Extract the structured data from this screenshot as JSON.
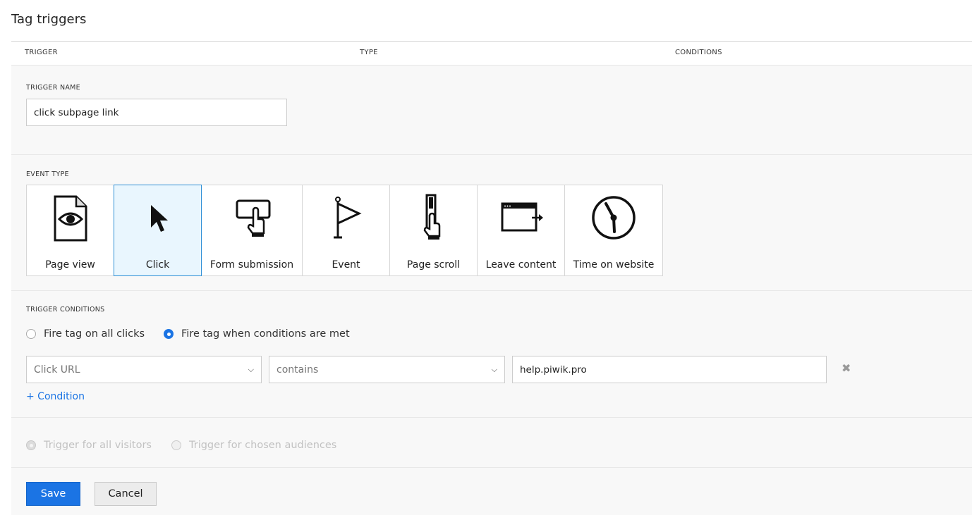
{
  "page": {
    "title": "Tag triggers"
  },
  "columns": {
    "trigger": "TRIGGER",
    "type": "TYPE",
    "conditions": "CONDITIONS"
  },
  "trigger_name": {
    "label": "TRIGGER NAME",
    "value": "click subpage link"
  },
  "event_type": {
    "label": "EVENT TYPE",
    "selected": "Click",
    "options": [
      {
        "label": "Page view",
        "icon": "page-view-icon"
      },
      {
        "label": "Click",
        "icon": "cursor-icon"
      },
      {
        "label": "Form submission",
        "icon": "form-submission-icon"
      },
      {
        "label": "Event",
        "icon": "flag-icon"
      },
      {
        "label": "Page scroll",
        "icon": "page-scroll-icon"
      },
      {
        "label": "Leave content",
        "icon": "leave-content-icon"
      },
      {
        "label": "Time on website",
        "icon": "clock-icon"
      }
    ]
  },
  "conditions": {
    "label": "TRIGGER CONDITIONS",
    "option_all": "Fire tag on all clicks",
    "option_conditional": "Fire tag when conditions are met",
    "selected": "conditional",
    "rule": {
      "variable": "Click URL",
      "operator": "contains",
      "value": "help.piwik.pro"
    },
    "add_label": "+ Condition"
  },
  "audience": {
    "option_all": "Trigger for all visitors",
    "option_chosen": "Trigger for chosen audiences"
  },
  "actions": {
    "save": "Save",
    "cancel": "Cancel"
  },
  "colors": {
    "primary": "#1b74e4",
    "selected_card_bg": "#e9f6fe",
    "selected_card_border": "#2e8fd6"
  }
}
